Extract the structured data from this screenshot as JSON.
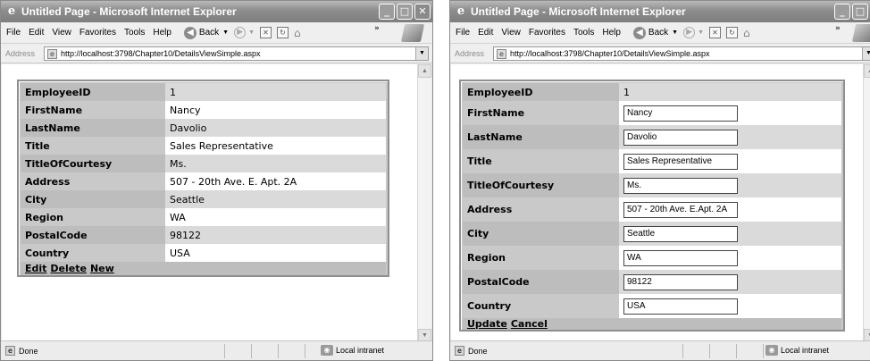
{
  "browser": {
    "title": "Untitled Page - Microsoft Internet Explorer",
    "menu": [
      "File",
      "Edit",
      "View",
      "Favorites",
      "Tools",
      "Help"
    ],
    "back_label": "Back",
    "address_label": "Address",
    "url": "http://localhost:3798/Chapter10/DetailsViewSimple.aspx",
    "status_text": "Done",
    "zone_text": "Local intranet"
  },
  "icons": {
    "ie": "ie-logo-icon",
    "minimize": "minimize-icon",
    "maximize": "maximize-icon",
    "close": "close-icon",
    "back": "back-arrow-icon",
    "forward": "forward-arrow-icon",
    "stop": "stop-icon",
    "refresh": "refresh-icon",
    "home": "home-icon",
    "windows_logo": "windows-logo-icon",
    "page": "page-icon",
    "intranet": "local-intranet-icon"
  },
  "fields": [
    {
      "label": "EmployeeID",
      "value": "1"
    },
    {
      "label": "FirstName",
      "value": "Nancy"
    },
    {
      "label": "LastName",
      "value": "Davolio"
    },
    {
      "label": "Title",
      "value": "Sales Representative"
    },
    {
      "label": "TitleOfCourtesy",
      "value": "Ms."
    },
    {
      "label": "Address",
      "value": "507 - 20th Ave. E. Apt. 2A"
    },
    {
      "label": "City",
      "value": "Seattle"
    },
    {
      "label": "Region",
      "value": "WA"
    },
    {
      "label": "PostalCode",
      "value": "98122"
    },
    {
      "label": "Country",
      "value": "USA"
    }
  ],
  "edit_address_value": "507 - 20th Ave. E.Apt. 2A",
  "read_commands": [
    "Edit",
    "Delete",
    "New"
  ],
  "edit_commands": [
    "Update",
    "Cancel"
  ],
  "colors": {
    "row_alt": "#dadada",
    "row_base": "#ffffff",
    "header_cell": "#bdbdbd",
    "border": "#8f8f8f"
  }
}
